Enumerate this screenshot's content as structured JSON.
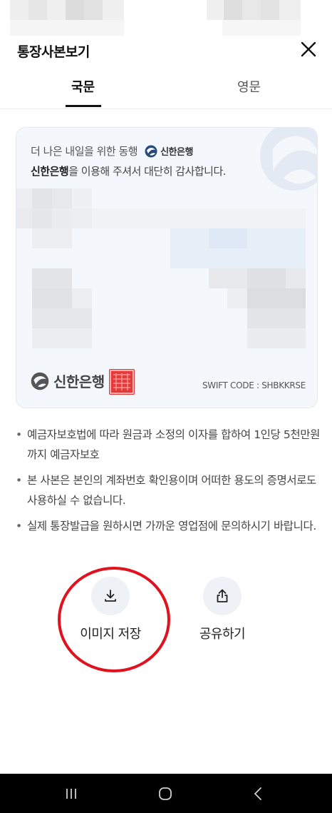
{
  "header": {
    "title": "통장사본보기",
    "close_icon": "close-icon"
  },
  "tabs": [
    {
      "label": "국문",
      "active": true
    },
    {
      "label": "영문",
      "active": false
    }
  ],
  "card": {
    "line1": "더 나은 내일을 위한 동행",
    "inline_logo": "신한은행",
    "line2_bold": "신한은행",
    "line2_rest": "을 이용해 주셔서 대단히 감사합니다.",
    "footer_logo": "신한은행",
    "swift_code": "SWIFT CODE : SHBKKRSE"
  },
  "notes": [
    "예금자보호법에 따라 원금과 소정의 이자를 합하여 1인당 5천만원까지 예금자보호",
    "본 사본은 본인의 계좌번호 확인용이며 어떠한 용도의 증명서로도 사용하실 수 없습니다.",
    "실제 통장발급을 원하시면 가까운 영업점에 문의하시기 바랍니다."
  ],
  "actions": {
    "save_label": "이미지 저장",
    "share_label": "공유하기"
  },
  "colors": {
    "accent": "#111111",
    "highlight": "#e0121f",
    "card_bg": "#f4f7fb"
  }
}
